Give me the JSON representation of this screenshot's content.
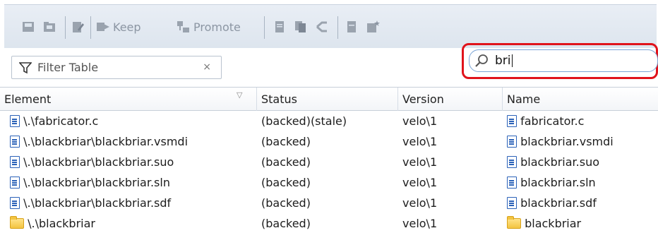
{
  "toolbar": {
    "keep_label": "Keep",
    "promote_label": "Promote",
    "icon_color": "#8c96a3"
  },
  "filter": {
    "label": "Filter Table",
    "clear_glyph": "×"
  },
  "search": {
    "value": "bri",
    "highlight_color": "#e0131b"
  },
  "table": {
    "headers": [
      "Element",
      "Status",
      "Version",
      "Name"
    ],
    "sort_glyph": "▽",
    "rows": [
      {
        "element": "\\.\\fabricator.c",
        "status": "(backed)(stale)",
        "version": "velo\\1",
        "name": "fabricator.c",
        "type": "file"
      },
      {
        "element": "\\.\\blackbriar\\blackbriar.vsmdi",
        "status": "(backed)",
        "version": "velo\\1",
        "name": "blackbriar.vsmdi",
        "type": "file"
      },
      {
        "element": "\\.\\blackbriar\\blackbriar.suo",
        "status": "(backed)",
        "version": "velo\\1",
        "name": "blackbriar.suo",
        "type": "file"
      },
      {
        "element": "\\.\\blackbriar\\blackbriar.sln",
        "status": "(backed)",
        "version": "velo\\1",
        "name": "blackbriar.sln",
        "type": "file"
      },
      {
        "element": "\\.\\blackbriar\\blackbriar.sdf",
        "status": "(backed)",
        "version": "velo\\1",
        "name": "blackbriar.sdf",
        "type": "file"
      },
      {
        "element": "\\.\\blackbriar",
        "status": "(backed)",
        "version": "velo\\1",
        "name": "blackbriar",
        "type": "folder"
      }
    ]
  }
}
